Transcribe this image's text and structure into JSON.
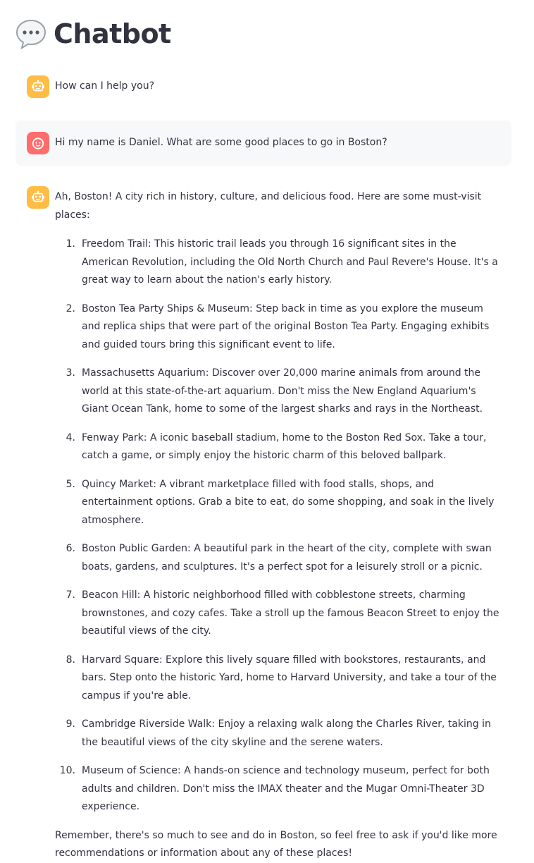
{
  "header": {
    "title": "Chatbot",
    "icon": "speech-bubble-icon"
  },
  "colors": {
    "bot_avatar": "#ffbd45",
    "user_avatar": "#ff6c6c",
    "user_bubble_bg": "#f7f8fa",
    "text": "#31333f"
  },
  "messages": {
    "greeting": {
      "role": "assistant",
      "avatar_icon": "robot-icon",
      "text": "How can I help you?"
    },
    "user_question": {
      "role": "user",
      "avatar_icon": "smiley-face-icon",
      "text": "Hi my name is Daniel. What are some good places to go in Boston?"
    },
    "answer": {
      "role": "assistant",
      "avatar_icon": "robot-icon",
      "intro": "Ah, Boston! A city rich in history, culture, and delicious food. Here are some must-visit places:",
      "items": [
        {
          "number": "1.",
          "text": "Freedom Trail: This historic trail leads you through 16 significant sites in the American Revolution, including the Old North Church and Paul Revere's House. It's a great way to learn about the nation's early history."
        },
        {
          "number": "2.",
          "text": "Boston Tea Party Ships & Museum: Step back in time as you explore the museum and replica ships that were part of the original Boston Tea Party. Engaging exhibits and guided tours bring this significant event to life."
        },
        {
          "number": "3.",
          "text": "Massachusetts Aquarium: Discover over 20,000 marine animals from around the world at this state-of-the-art aquarium. Don't miss the New England Aquarium's Giant Ocean Tank, home to some of the largest sharks and rays in the Northeast."
        },
        {
          "number": "4.",
          "text": "Fenway Park: A iconic baseball stadium, home to the Boston Red Sox. Take a tour, catch a game, or simply enjoy the historic charm of this beloved ballpark."
        },
        {
          "number": "5.",
          "text": "Quincy Market: A vibrant marketplace filled with food stalls, shops, and entertainment options. Grab a bite to eat, do some shopping, and soak in the lively atmosphere."
        },
        {
          "number": "6.",
          "text": "Boston Public Garden: A beautiful park in the heart of the city, complete with swan boats, gardens, and sculptures. It's a perfect spot for a leisurely stroll or a picnic."
        },
        {
          "number": "7.",
          "text": "Beacon Hill: A historic neighborhood filled with cobblestone streets, charming brownstones, and cozy cafes. Take a stroll up the famous Beacon Street to enjoy the beautiful views of the city."
        },
        {
          "number": "8.",
          "text": "Harvard Square: Explore this lively square filled with bookstores, restaurants, and bars. Step onto the historic Yard, home to Harvard University, and take a tour of the campus if you're able."
        },
        {
          "number": "9.",
          "text": "Cambridge Riverside Walk: Enjoy a relaxing walk along the Charles River, taking in the beautiful views of the city skyline and the serene waters."
        },
        {
          "number": "10.",
          "text": "Museum of Science: A hands-on science and technology museum, perfect for both adults and children. Don't miss the IMAX theater and the Mugar Omni-Theater 3D experience."
        }
      ],
      "closing": "Remember, there's so much to see and do in Boston, so feel free to ask if you'd like more recommendations or information about any of these places!"
    }
  }
}
